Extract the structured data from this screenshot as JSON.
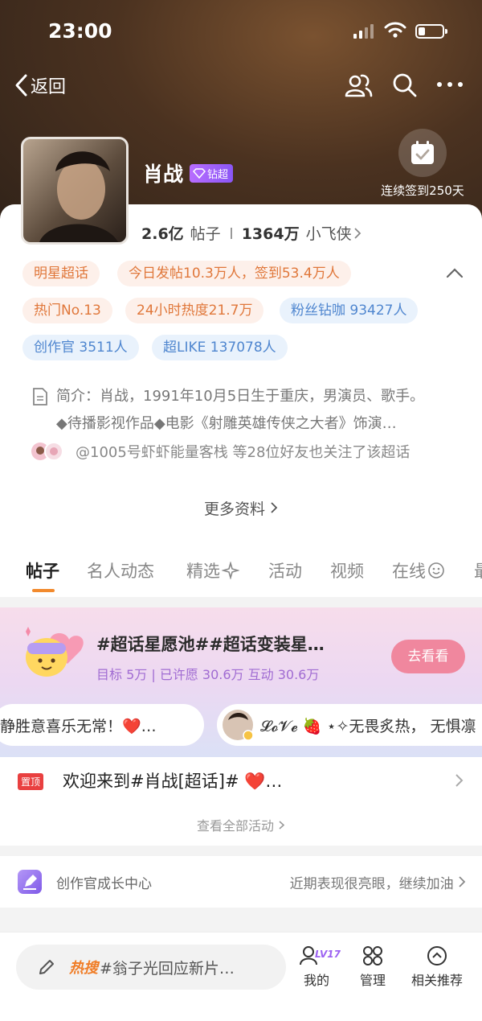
{
  "status_bar": {
    "time": "23:00",
    "battery_level": 0.3
  },
  "nav": {
    "back_label": "返回"
  },
  "profile": {
    "name": "肖战",
    "badge": "钻超",
    "checkin_label": "连续签到250天",
    "posts_count": "2.6亿",
    "posts_label": "帖子",
    "fans_count": "1364万",
    "fans_label": "小飞侠"
  },
  "tags": [
    {
      "text": "明星超话",
      "style": "orange"
    },
    {
      "text": "今日发帖10.3万人，签到53.4万人",
      "style": "orange"
    },
    {
      "text": "热门No.13",
      "style": "orange"
    },
    {
      "text": "24小时热度21.7万",
      "style": "orange"
    },
    {
      "text": "粉丝钻咖 93427人",
      "style": "blue"
    },
    {
      "text": "创作官 3511人",
      "style": "blue"
    },
    {
      "text": "超LIKE 137078人",
      "style": "blue"
    }
  ],
  "intro": {
    "line1": "简介：肖战，1991年10月5日生于重庆，男演员、歌手。",
    "line2": "◆待播影视作品◆电影《射雕英雄传侠之大者》饰演…"
  },
  "friends_text": "@1005号虾虾能量客栈 等28位好友也关注了该超话",
  "more_label": "更多资料",
  "tabs": [
    "帖子",
    "名人动态",
    "精选",
    "活动",
    "视频",
    "在线",
    "最"
  ],
  "banner": {
    "title": "#超话星愿池##超话变装星…",
    "subtitle": "目标 5万 | 已许愿 30.6万 互动 30.6万",
    "button": "去看看",
    "marquee_left": "静胜意喜乐无常！❤️…",
    "marquee_right": "𝓛𝓸𝓥𝓮 🍓 ⋆✧无畏炙热， 无惧凛"
  },
  "pinned": {
    "tag": "置顶",
    "text": "欢迎来到#肖战[超话]# ❤️…",
    "see_all": "查看全部活动"
  },
  "growth": {
    "label": "创作官成长中心",
    "right_text": "近期表现很亮眼，继续加油"
  },
  "bottom": {
    "hot_tag": "热搜",
    "search_text": "#翁子光回应新片…",
    "level_badge": "LV17",
    "my_label": "我的",
    "manage_label": "管理",
    "recommend_label": "相关推荐"
  }
}
